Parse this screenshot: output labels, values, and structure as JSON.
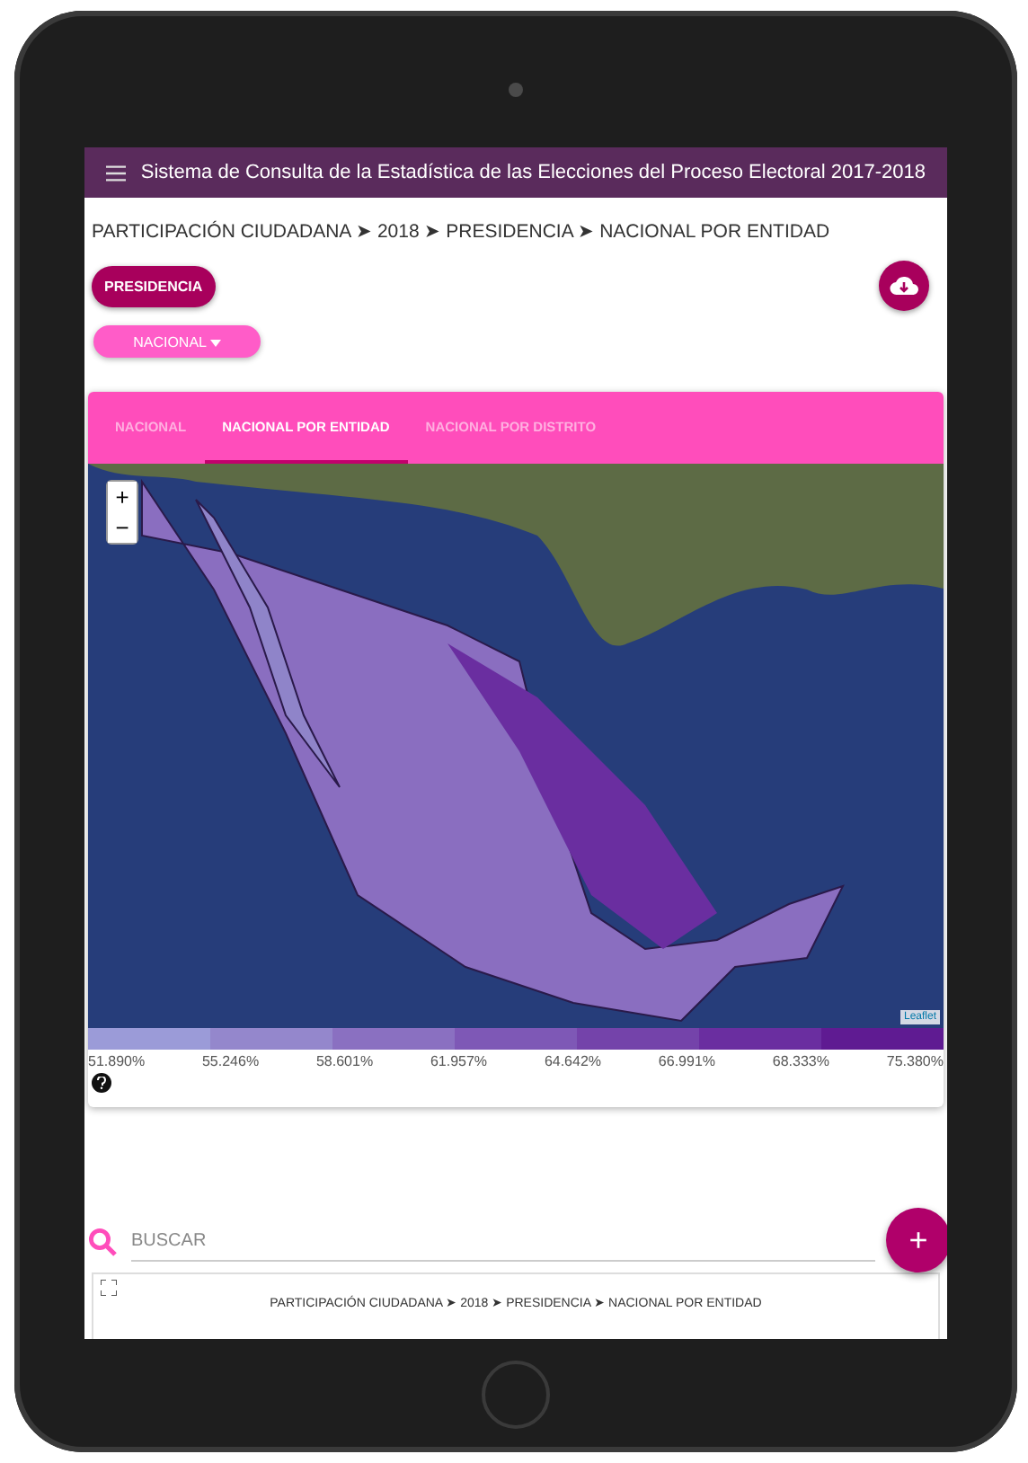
{
  "header": {
    "title": "Sistema de Consulta de la Estadística de las Elecciones del Proceso Electoral 2017-2018"
  },
  "breadcrumb": "PARTICIPACIÓN CIUDADANA ➤ 2018 ➤ PRESIDENCIA ➤ NACIONAL POR ENTIDAD",
  "election_chip": "PRESIDENCIA",
  "level_dropdown": "NACIONAL",
  "tabs": [
    {
      "label": "NACIONAL",
      "selected": false
    },
    {
      "label": "NACIONAL POR ENTIDAD",
      "selected": true
    },
    {
      "label": "NACIONAL POR DISTRITO",
      "selected": false
    }
  ],
  "map": {
    "zoom_in": "+",
    "zoom_out": "−",
    "attribution": "Leaflet"
  },
  "legend": {
    "swatches": [
      {
        "color": "#9b9bd8"
      },
      {
        "color": "#9487cc"
      },
      {
        "color": "#8a70c1"
      },
      {
        "color": "#7e58b6"
      },
      {
        "color": "#7443aa"
      },
      {
        "color": "#6a2ea0"
      },
      {
        "color": "#5f1b92"
      }
    ],
    "labels": [
      "51.890%",
      "55.246%",
      "58.601%",
      "61.957%",
      "64.642%",
      "66.991%",
      "68.333%",
      "75.380%"
    ]
  },
  "search": {
    "placeholder": "BUSCAR"
  },
  "fab": "+",
  "table": {
    "caption": "PARTICIPACIÓN CIUDADANA ➤ 2018 ➤ PRESIDENCIA ➤ NACIONAL POR ENTIDAD"
  }
}
